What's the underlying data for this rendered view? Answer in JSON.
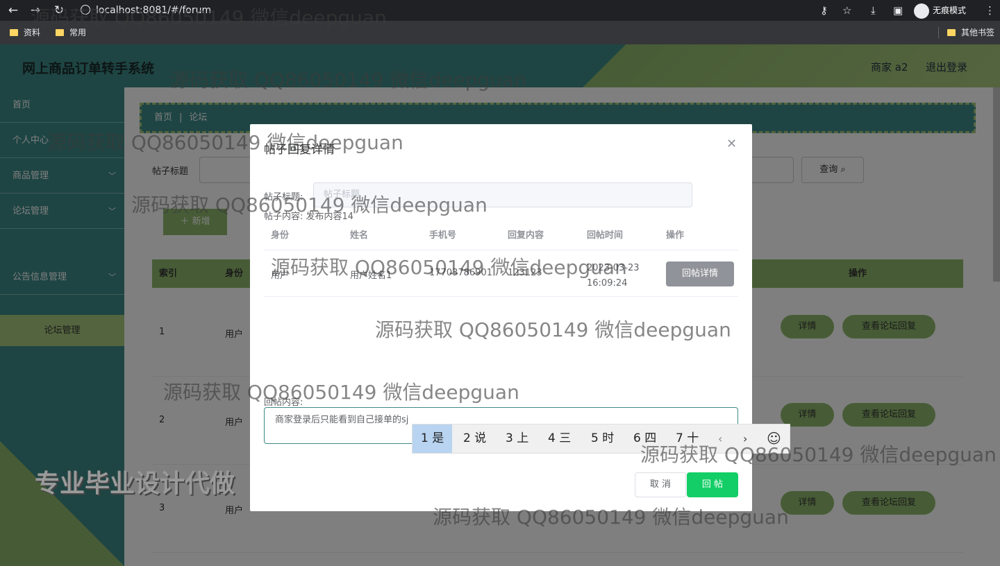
{
  "browser": {
    "url": "localhost:8081/#/forum",
    "incognito_label": "无痕模式",
    "bookmarks": [
      "资料",
      "常用"
    ],
    "other_bookmarks": "其他书签"
  },
  "header": {
    "title": "网上商品订单转手系统",
    "user": "商家 a2",
    "logout": "退出登录"
  },
  "sidebar": {
    "items": [
      {
        "label": "首页"
      },
      {
        "label": "个人中心"
      },
      {
        "label": "商品管理"
      },
      {
        "label": "论坛管理"
      },
      {
        "label": "公告信息管理"
      }
    ],
    "active_sub": "论坛管理"
  },
  "main": {
    "breadcrumb": [
      "首页",
      "论坛"
    ],
    "search_label": "帖子标题",
    "query_label": "查询",
    "add_label": "新增",
    "columns": [
      "索引",
      "身份",
      "操作"
    ],
    "rows": [
      {
        "index": "1",
        "role": "用户"
      },
      {
        "index": "2",
        "role": "用户"
      },
      {
        "index": "3",
        "role": "用户"
      }
    ],
    "detail_label": "详情",
    "view_replies_label": "查看论坛回复"
  },
  "dialog": {
    "title": "帖子回复详情",
    "title_field_label": "帖子标题:",
    "title_field_placeholder": "帖子标题",
    "content_label": "帖子内容: 发布内容14",
    "table_columns": [
      "身份",
      "姓名",
      "手机号",
      "回复内容",
      "回帖时间",
      "操作"
    ],
    "table_rows": [
      {
        "role": "用户",
        "name": "用户姓名1",
        "phone": "17703786901",
        "content": "123123",
        "time": "2023-03-23 16:09:24",
        "action": "回帖详情"
      }
    ],
    "reply_label": "回帖内容:",
    "reply_value": "商家登录后只能看到自己接单的sj",
    "cancel": "取 消",
    "submit": "回 帖"
  },
  "ime": {
    "candidates": [
      "1 是",
      "2 说",
      "3 上",
      "4 三",
      "5 时",
      "6 四",
      "7 十"
    ],
    "selected": 0
  },
  "watermark": {
    "text": "源码获取 QQ86050149 微信deepguan",
    "big": "专业毕业设计代做"
  }
}
